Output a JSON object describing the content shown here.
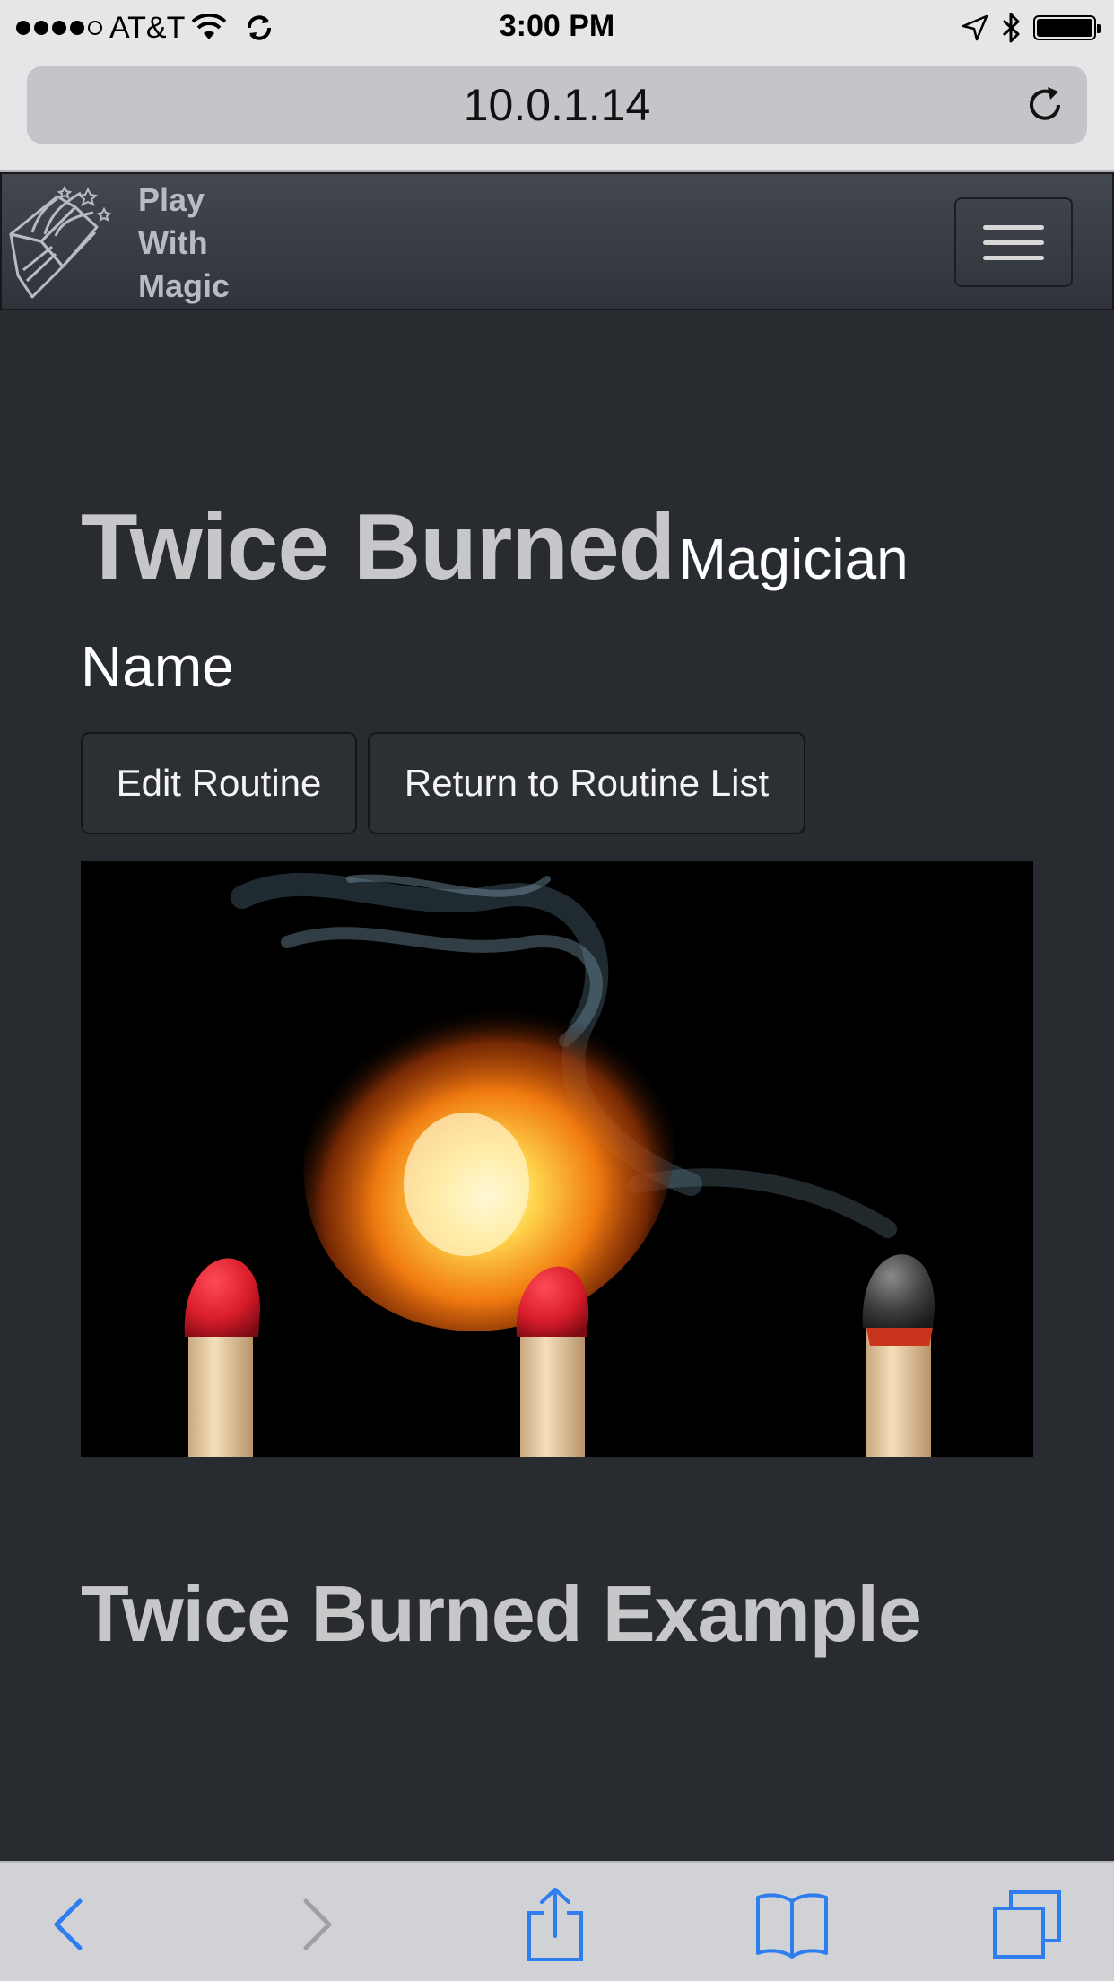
{
  "status_bar": {
    "carrier": "AT&T",
    "time": "3:00 PM",
    "signal_bars_filled": 4,
    "signal_bars_total": 5,
    "battery_level": 1.0,
    "icons": [
      "wifi-icon",
      "sync-icon",
      "location-icon",
      "bluetooth-icon",
      "battery-icon"
    ]
  },
  "browser": {
    "url": "10.0.1.14",
    "reload_icon": "reload-icon",
    "toolbar_icons": [
      "back-icon",
      "forward-icon",
      "share-icon",
      "bookmarks-icon",
      "tabs-icon"
    ]
  },
  "navbar": {
    "brand_lines": [
      "Play",
      "With",
      "Magic"
    ],
    "logo_icon": "magic-book-icon",
    "menu_icon": "hamburger-icon"
  },
  "page": {
    "title": "Twice Burned",
    "subtitle": "Magician Name",
    "edit_button": "Edit Routine",
    "return_button": "Return to Routine List",
    "section_heading": "Twice Burned Example"
  },
  "colors": {
    "background": "#282b30",
    "navbar": "#3a3d44",
    "heading": "#c7c7c9",
    "ios_blue": "#2f7ef0",
    "match_head": "#d81c2a"
  }
}
